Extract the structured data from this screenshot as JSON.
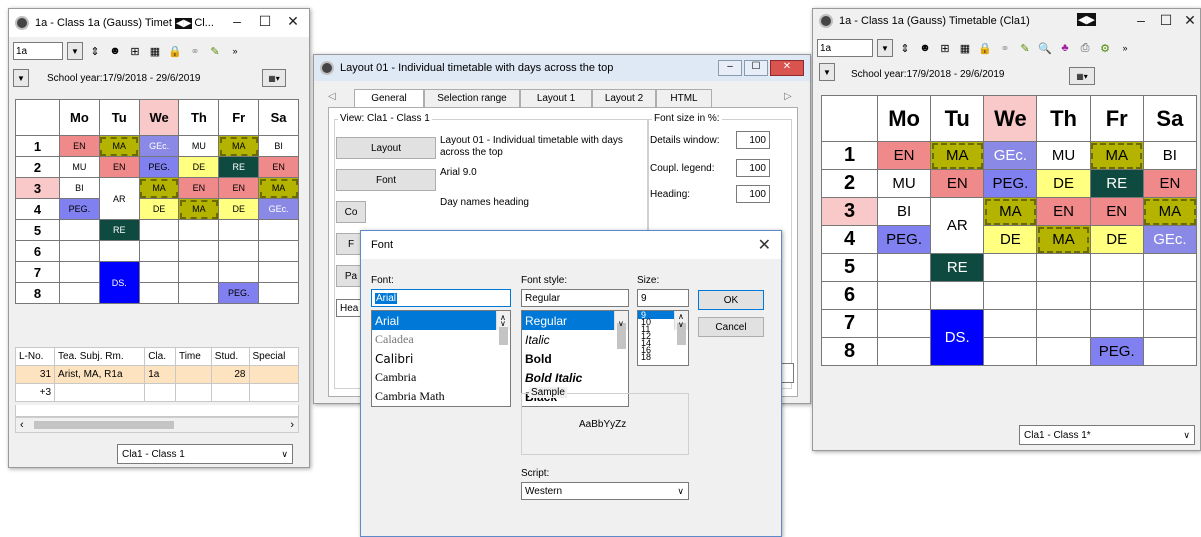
{
  "left": {
    "title": "1a - Class 1a (Gauss) Timet",
    "title_tail": "Cl...",
    "combo_value": "1a",
    "school_year": "School year:17/9/2018 - 29/6/2019",
    "days": [
      "Mo",
      "Tu",
      "We",
      "Th",
      "Fr",
      "Sa"
    ],
    "periods": [
      "1",
      "2",
      "3",
      "4",
      "5",
      "6",
      "7",
      "8"
    ],
    "lesson_headers": [
      "L-No.",
      "Tea. Subj. Rm.",
      "Cla.",
      "Time",
      "Stud.",
      "Special"
    ],
    "lesson_rows": [
      [
        "31",
        "Arist, MA, R1a",
        "1a",
        "",
        "28",
        ""
      ],
      [
        "+3",
        "",
        "",
        "",
        "",
        ""
      ]
    ],
    "footer_select": "Cla1 - Class 1"
  },
  "timetable_cells": {
    "EN": "EN",
    "MA": "MA",
    "GEc": "GEc.",
    "MU": "MU",
    "BI": "BI",
    "DE": "DE",
    "RE": "RE",
    "PEG": "PEG.",
    "AR": "AR",
    "DS": "DS."
  },
  "layout_dialog": {
    "title": "Layout 01 - Individual timetable with days across the top",
    "tabs": [
      "General",
      "Selection range",
      "Layout 1",
      "Layout 2",
      "HTML"
    ],
    "view_group": "View: Cla1 - Class 1",
    "btn_layout": "Layout",
    "btn_font": "Font",
    "btn_c": "Co",
    "btn_f": "F",
    "btn_p": "Pa",
    "btn_h": "Hea",
    "layout_desc": "Layout 01 - Individual timetable with days across the top",
    "font_desc": "Arial 9.0",
    "day_names_heading": "Day names heading",
    "font_size_group": "Font size in %:",
    "details_label": "Details window:",
    "details_value": "100",
    "coupl_label": "Coupl. legend:",
    "coupl_value": "100",
    "heading_label": "Heading:",
    "heading_value": "100"
  },
  "font_dialog": {
    "title": "Font",
    "font_label": "Font:",
    "font_value": "Arial",
    "fonts": [
      "Arial",
      "Caladea",
      "Calibri",
      "Cambria",
      "Cambria Math"
    ],
    "style_label": "Font style:",
    "style_value": "Regular",
    "styles": [
      "Regular",
      "Italic",
      "Bold",
      "Bold Italic",
      "Black"
    ],
    "size_label": "Size:",
    "size_value": "9",
    "sizes": [
      "9",
      "10",
      "11",
      "12",
      "14",
      "16",
      "18"
    ],
    "ok": "OK",
    "cancel": "Cancel",
    "sample_label": "Sample",
    "sample_text": "AaBbYyZz",
    "script_label": "Script:",
    "script_value": "Western"
  },
  "right": {
    "title": "1a - Class 1a (Gauss)  Timetable  (Cla1)",
    "combo_value": "1a",
    "school_year": "School year:17/9/2018 - 29/6/2019",
    "footer_select": "Cla1 - Class 1*"
  }
}
